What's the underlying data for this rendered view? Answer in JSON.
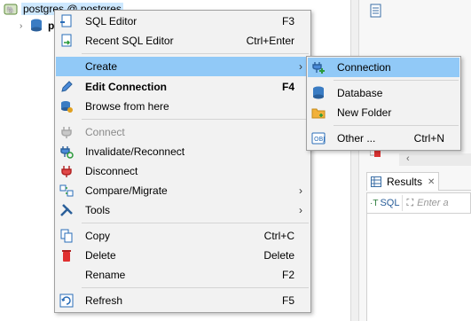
{
  "tree": {
    "connection_label": "postgres @ postgres",
    "child_label": "p"
  },
  "context_menu": {
    "items": [
      {
        "label": "SQL Editor",
        "shortcut": "F3"
      },
      {
        "label": "Recent SQL Editor",
        "shortcut": "Ctrl+Enter"
      },
      {
        "label": "Create",
        "shortcut": ""
      },
      {
        "label": "Edit Connection",
        "shortcut": "F4"
      },
      {
        "label": "Browse from here",
        "shortcut": ""
      },
      {
        "label": "Connect",
        "shortcut": ""
      },
      {
        "label": "Invalidate/Reconnect",
        "shortcut": ""
      },
      {
        "label": "Disconnect",
        "shortcut": ""
      },
      {
        "label": "Compare/Migrate",
        "shortcut": ""
      },
      {
        "label": "Tools",
        "shortcut": ""
      },
      {
        "label": "Copy",
        "shortcut": "Ctrl+C"
      },
      {
        "label": "Delete",
        "shortcut": "Delete"
      },
      {
        "label": "Rename",
        "shortcut": "F2"
      },
      {
        "label": "Refresh",
        "shortcut": "F5"
      }
    ]
  },
  "create_submenu": {
    "items": [
      {
        "label": "Connection",
        "shortcut": ""
      },
      {
        "label": "Database",
        "shortcut": ""
      },
      {
        "label": "New Folder",
        "shortcut": ""
      },
      {
        "label": "Other ...",
        "shortcut": "Ctrl+N"
      }
    ]
  },
  "results_panel": {
    "tab_label": "Results",
    "sql_button": "SQL",
    "filter_placeholder": "Enter a"
  },
  "colors": {
    "menu_bg": "#f2f2f2",
    "highlight": "#91c9f7",
    "selection": "#cde8ff"
  }
}
